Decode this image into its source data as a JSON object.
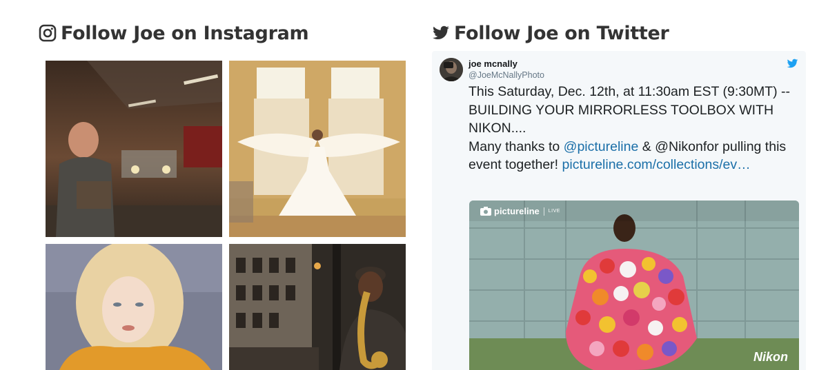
{
  "instagram": {
    "title": "Follow Joe on Instagram",
    "icon": "instagram-icon"
  },
  "twitter": {
    "title": "Follow Joe on Twitter",
    "icon": "twitter-bird-icon",
    "tweet": {
      "author_name": "joe mcnally",
      "author_handle": "@JoeMcNallyPhoto",
      "text_line_1": "This Saturday, Dec. 12th, at 11:30am EST (9:30MT) -- BUILDING YOUR MIRRORLESS TOOLBOX WITH NIKON....",
      "text_pre": "Many thanks to ",
      "mention": "@pictureline",
      "text_mid": " & @Nikonfor pulling this event together! ",
      "link": "pictureline.com/collections/ev…",
      "media": {
        "logo_text": "pictureline",
        "logo_sub": "LIVE",
        "brand_text": "Nikon"
      }
    }
  },
  "colors": {
    "heading": "#333333",
    "link": "#1b6fa8",
    "tweet_bg": "#f5f8fa",
    "twitter_blue": "#1da1f2"
  }
}
